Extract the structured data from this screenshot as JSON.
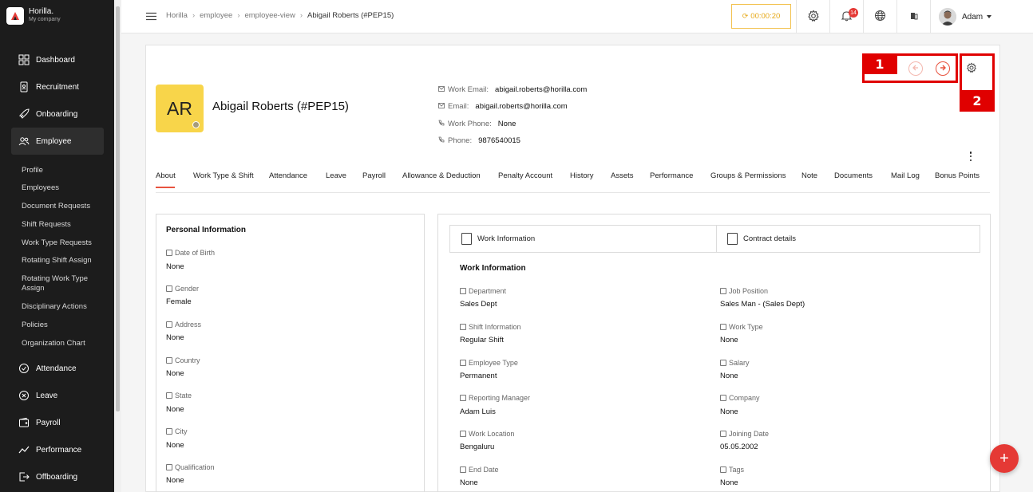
{
  "brand": {
    "name": "Horilla.",
    "company": "My company"
  },
  "sidebar": {
    "items": [
      {
        "label": "Dashboard",
        "icon": "dashboard-icon"
      },
      {
        "label": "Recruitment",
        "icon": "recruitment-icon"
      },
      {
        "label": "Onboarding",
        "icon": "rocket-icon"
      },
      {
        "label": "Employee",
        "icon": "employee-icon"
      },
      {
        "label": "Attendance",
        "icon": "attendance-icon"
      },
      {
        "label": "Leave",
        "icon": "leave-icon"
      },
      {
        "label": "Payroll",
        "icon": "wallet-icon"
      },
      {
        "label": "Performance",
        "icon": "chart-line-icon"
      },
      {
        "label": "Offboarding",
        "icon": "offboarding-icon"
      }
    ],
    "sub_items": [
      "Profile",
      "Employees",
      "Document Requests",
      "Shift Requests",
      "Work Type Requests",
      "Rotating Shift Assign",
      "Rotating Work Type Assign",
      "Disciplinary Actions",
      "Policies",
      "Organization Chart"
    ]
  },
  "breadcrumb": [
    "Horilla",
    "employee",
    "employee-view",
    "Abigail Roberts (#PEP15)"
  ],
  "topbar": {
    "timer": "00:00:20",
    "notification_count": "14",
    "user_name": "Adam"
  },
  "employee": {
    "initials": "AR",
    "name": "Abigail Roberts (#PEP15)",
    "contacts": [
      {
        "label": "Work Email:",
        "value": "abigail.roberts@horilla.com"
      },
      {
        "label": "Email:",
        "value": "abigail.roberts@horilla.com"
      },
      {
        "label": "Work Phone:",
        "value": "None"
      },
      {
        "label": "Phone:",
        "value": "9876540015"
      }
    ]
  },
  "annotations": {
    "one": "1",
    "two": "2"
  },
  "tabs": [
    "About",
    "Work Type & Shift",
    "Attendance",
    "Leave",
    "Payroll",
    "Allowance & Deduction",
    "Penalty Account",
    "History",
    "Assets",
    "Performance",
    "Groups & Permissions",
    "Note",
    "Documents",
    "Mail Log",
    "Bonus Points"
  ],
  "personal": {
    "title": "Personal Information",
    "fields": [
      {
        "label": "Date of Birth",
        "value": "None"
      },
      {
        "label": "Gender",
        "value": "Female"
      },
      {
        "label": "Address",
        "value": "None"
      },
      {
        "label": "Country",
        "value": "None"
      },
      {
        "label": "State",
        "value": "None"
      },
      {
        "label": "City",
        "value": "None"
      },
      {
        "label": "Qualification",
        "value": "None"
      }
    ]
  },
  "work": {
    "tab_work": "Work Information",
    "tab_contract": "Contract details",
    "title": "Work Information",
    "left": [
      {
        "label": "Department",
        "value": "Sales Dept"
      },
      {
        "label": "Shift Information",
        "value": "Regular Shift"
      },
      {
        "label": "Employee Type",
        "value": "Permanent"
      },
      {
        "label": "Reporting Manager",
        "value": "Adam Luis"
      },
      {
        "label": "Work Location",
        "value": "Bengaluru"
      },
      {
        "label": "End Date",
        "value": "None"
      }
    ],
    "right": [
      {
        "label": "Job Position",
        "value": "Sales Man - (Sales Dept)"
      },
      {
        "label": "Work Type",
        "value": "None"
      },
      {
        "label": "Salary",
        "value": "None"
      },
      {
        "label": "Company",
        "value": "None"
      },
      {
        "label": "Joining Date",
        "value": "05.05.2002"
      },
      {
        "label": "Tags",
        "value": "None"
      }
    ]
  },
  "fab": "+",
  "colors": {
    "accent": "#e8533f",
    "annotation": "#e00000",
    "avatar_bg": "#f8d54a",
    "sidebar_bg": "#1c1c1c"
  }
}
